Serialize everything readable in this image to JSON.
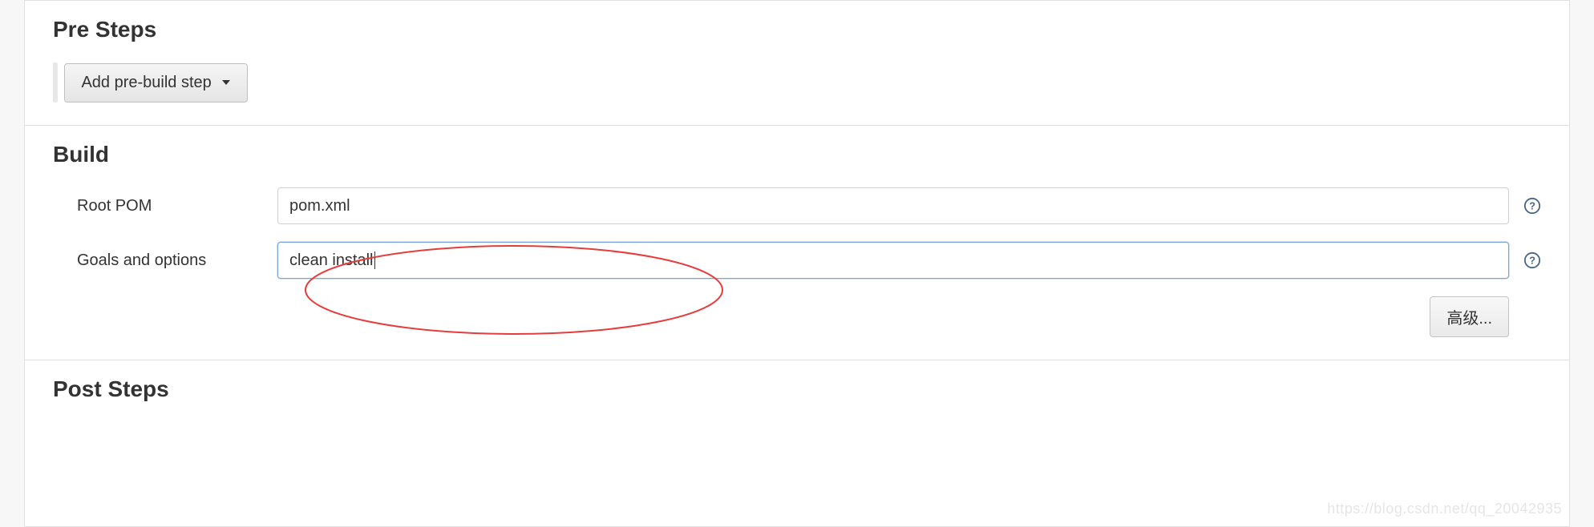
{
  "sections": {
    "preSteps": {
      "title": "Pre Steps",
      "addButtonLabel": "Add pre-build step"
    },
    "build": {
      "title": "Build",
      "rootPom": {
        "label": "Root POM",
        "value": "pom.xml"
      },
      "goals": {
        "label": "Goals and options",
        "value": "clean install"
      },
      "advancedLabel": "高级..."
    },
    "postSteps": {
      "title": "Post Steps"
    }
  },
  "watermark": "https://blog.csdn.net/qq_20042935"
}
